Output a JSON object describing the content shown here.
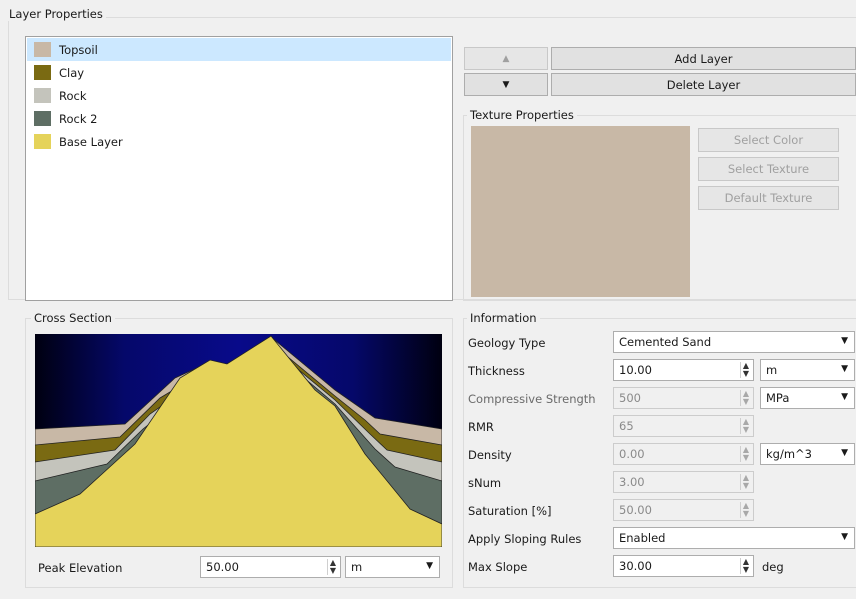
{
  "layer_properties": {
    "title": "Layer Properties",
    "layers": [
      {
        "name": "Topsoil",
        "color": "#c8b8a6",
        "selected": true
      },
      {
        "name": "Clay",
        "color": "#7a6a12"
      },
      {
        "name": "Rock",
        "color": "#c4c4bc"
      },
      {
        "name": "Rock 2",
        "color": "#5e6e64"
      },
      {
        "name": "Base Layer",
        "color": "#e5d35a"
      }
    ]
  },
  "layer_buttons": {
    "move_up": "▲",
    "move_down": "▼",
    "add": "Add Layer",
    "delete": "Delete Layer"
  },
  "texture_properties": {
    "title": "Texture Properties",
    "preview_color": "#c8b8a6",
    "select_color": "Select Color",
    "select_texture": "Select Texture",
    "default_texture": "Default Texture"
  },
  "information": {
    "title": "Information",
    "geology_type": {
      "label": "Geology Type",
      "value": "Cemented Sand"
    },
    "thickness": {
      "label": "Thickness",
      "value": "10.00",
      "unit": "m"
    },
    "compressive_strength": {
      "label": "Compressive Strength",
      "value": "500",
      "unit": "MPa"
    },
    "rmr": {
      "label": "RMR",
      "value": "65"
    },
    "density": {
      "label": "Density",
      "value": "0.00",
      "unit": "kg/m^3"
    },
    "snum": {
      "label": "sNum",
      "value": "3.00"
    },
    "saturation": {
      "label": "Saturation [%]",
      "value": "50.00"
    },
    "apply_sloping_rules": {
      "label": "Apply Sloping Rules",
      "value": "Enabled"
    },
    "max_slope": {
      "label": "Max Slope",
      "value": "30.00",
      "unit": "deg"
    }
  },
  "cross_section": {
    "title": "Cross Section",
    "peak_elevation": {
      "label": "Peak Elevation",
      "value": "50.00",
      "unit": "m"
    }
  },
  "icons": {
    "spin_up": "▲",
    "spin_down": "▼",
    "dropdown": "▼"
  }
}
